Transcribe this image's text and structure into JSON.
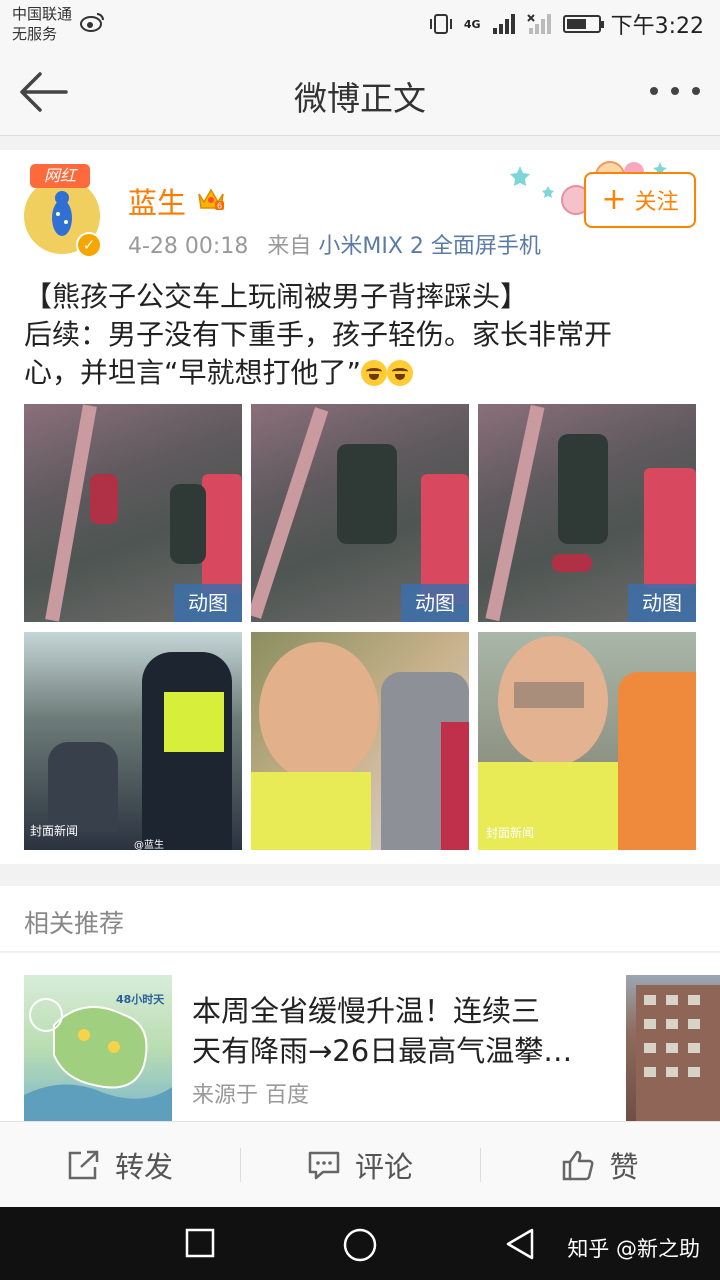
{
  "status_bar": {
    "carrier_line1": "中国联通",
    "carrier_line2": "无服务",
    "network": "4G",
    "time": "下午3:22",
    "battery_level": 0.65
  },
  "nav": {
    "title": "微博正文"
  },
  "post": {
    "badge": "网红",
    "username": "蓝生",
    "timestamp": "4-28 00:18",
    "source_prefix": "来自",
    "source": "小米MIX 2 全面屏手机",
    "follow_label": "关注",
    "text_line1": "【熊孩子公交车上玩闹被男子背摔踩头】",
    "text_line2": "后续：男子没有下重手，孩子轻伤。家长非常开",
    "text_line3": "心，并坦言“早就想打他了”",
    "gif_label": "动图",
    "image_watermark_1": "封面新闻",
    "image_watermark_2": "@蓝生",
    "image_watermark_3": "封面新闻"
  },
  "related": {
    "header": "相关推荐",
    "item_title": "本周全省缓慢升温！连续三天有降雨→26日最高气温攀…",
    "item_title_line1": "本周全省缓慢升温！连续三",
    "item_title_line2": "天有降雨→26日最高气温攀…",
    "item_source": "来源于 百度",
    "thumb_caption": "48小时天"
  },
  "actions": {
    "repost": "转发",
    "comment": "评论",
    "like": "赞"
  },
  "system_nav": {
    "watermark": "知乎 @新之助"
  },
  "colors": {
    "accent_orange": "#ff8200",
    "username_orange": "#ff7a00",
    "link_blue": "#5b7ba6",
    "gif_badge": "#3c6eaa"
  }
}
